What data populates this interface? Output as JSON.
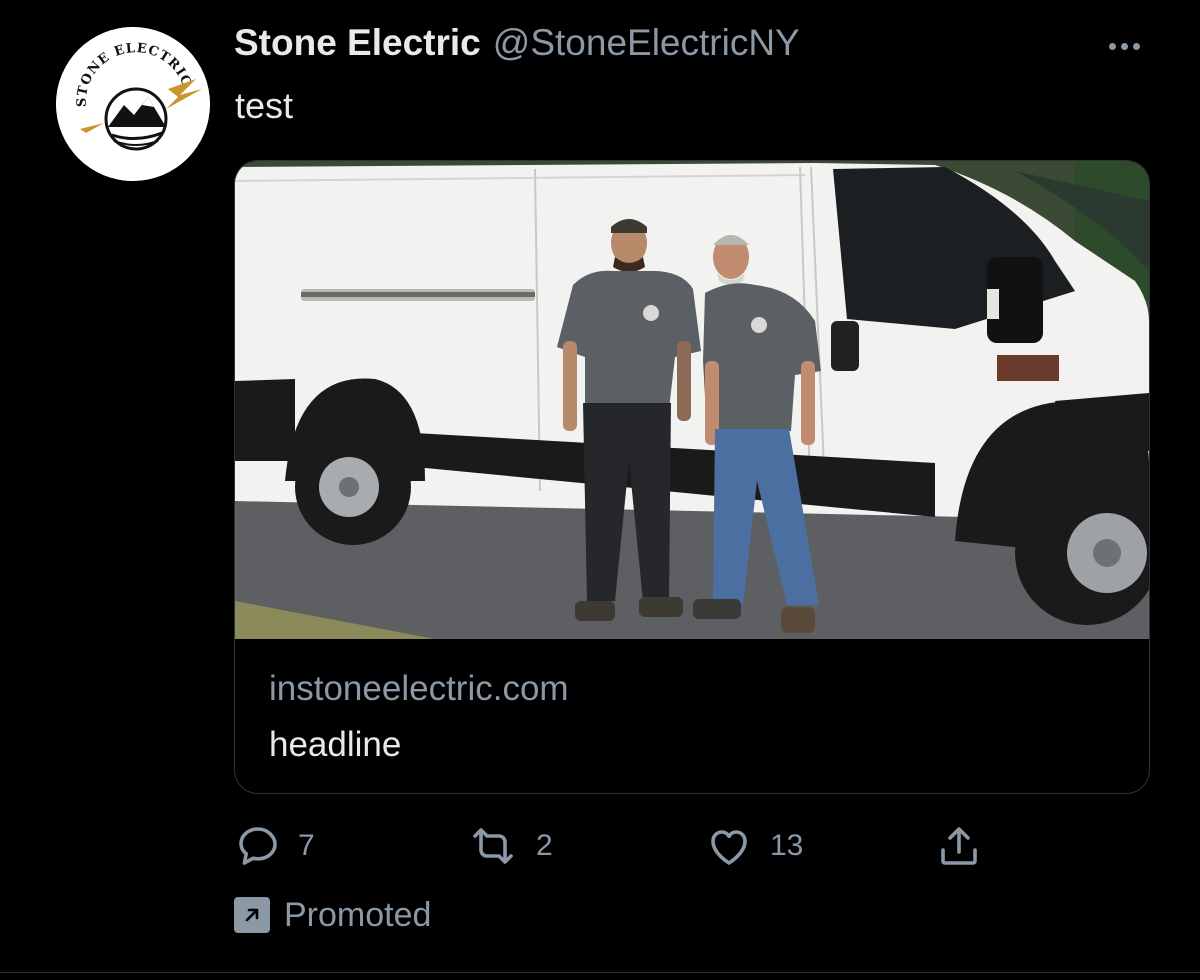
{
  "author": {
    "display_name": "Stone Electric",
    "handle": "@StoneElectricNY",
    "avatar_text": "STONE ELECTRIC"
  },
  "tweet": {
    "text": "test"
  },
  "card": {
    "domain": "instoneelectric.com",
    "headline": "headline",
    "image_alt": "Two men in grey company t-shirts standing in front of a white cargo van"
  },
  "actions": {
    "replies": "7",
    "retweets": "2",
    "likes": "13"
  },
  "promoted": {
    "label": "Promoted"
  },
  "colors": {
    "background": "#000000",
    "primary_text": "#e7e9ea",
    "secondary_text": "#8b98a5",
    "border": "#2f3336"
  },
  "icons": {
    "more": "more-horizontal-icon",
    "reply": "reply-bubble-icon",
    "retweet": "retweet-icon",
    "like": "heart-icon",
    "share": "share-upload-icon",
    "promoted": "promoted-arrow-icon"
  }
}
